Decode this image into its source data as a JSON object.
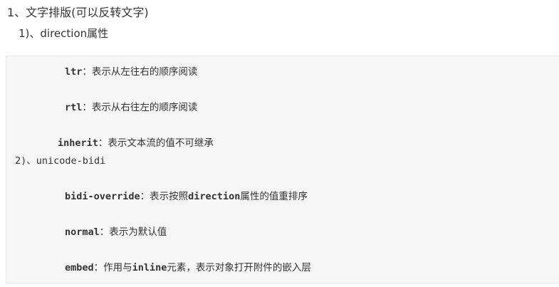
{
  "heading": "1、文字排版(可以反转文字)",
  "subheading": "1)、direction属性",
  "code": {
    "ltr": {
      "keyword": "ltr",
      "sep": "：",
      "desc": "表示从左往右的顺序阅读"
    },
    "rtl": {
      "keyword": "rtl",
      "sep": "：",
      "desc": "表示从右往左的顺序阅读"
    },
    "inherit": {
      "keyword": "inherit",
      "sep": "：",
      "desc": "表示文本流的值不可继承"
    },
    "section2": "2)、unicode-bidi",
    "bidi_override": {
      "keyword": "bidi-override",
      "sep": "：",
      "desc1": "表示按照",
      "kw2": "direction",
      "desc2": "属性的值重排序"
    },
    "normal": {
      "keyword": "normal",
      "sep": "：",
      "desc": "表示为默认值"
    },
    "embed": {
      "keyword": "embed",
      "sep": "：",
      "desc1": "作用与",
      "kw2": "inline",
      "desc2": "元素，表示对象打开附件的嵌入层"
    }
  }
}
